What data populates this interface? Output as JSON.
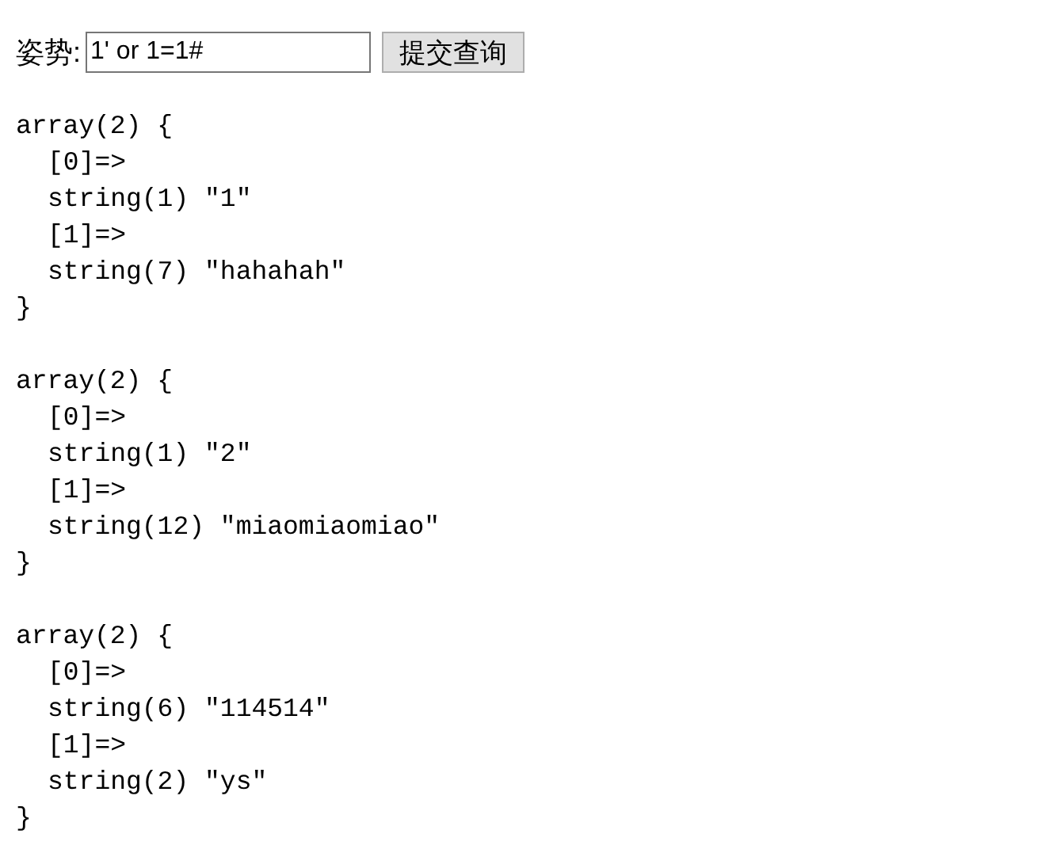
{
  "form": {
    "label": "姿势:",
    "value": "1' or 1=1#",
    "button": "提交查询"
  },
  "dumps": [
    {
      "header": "array(2) {",
      "entries": [
        {
          "key": "[0]=>",
          "value": "string(1) \"1\""
        },
        {
          "key": "[1]=>",
          "value": "string(7) \"hahahah\""
        }
      ],
      "footer": "}"
    },
    {
      "header": "array(2) {",
      "entries": [
        {
          "key": "[0]=>",
          "value": "string(1) \"2\""
        },
        {
          "key": "[1]=>",
          "value": "string(12) \"miaomiaomiao\""
        }
      ],
      "footer": "}"
    },
    {
      "header": "array(2) {",
      "entries": [
        {
          "key": "[0]=>",
          "value": "string(6) \"114514\""
        },
        {
          "key": "[1]=>",
          "value": "string(2) \"ys\""
        }
      ],
      "footer": "}"
    }
  ]
}
